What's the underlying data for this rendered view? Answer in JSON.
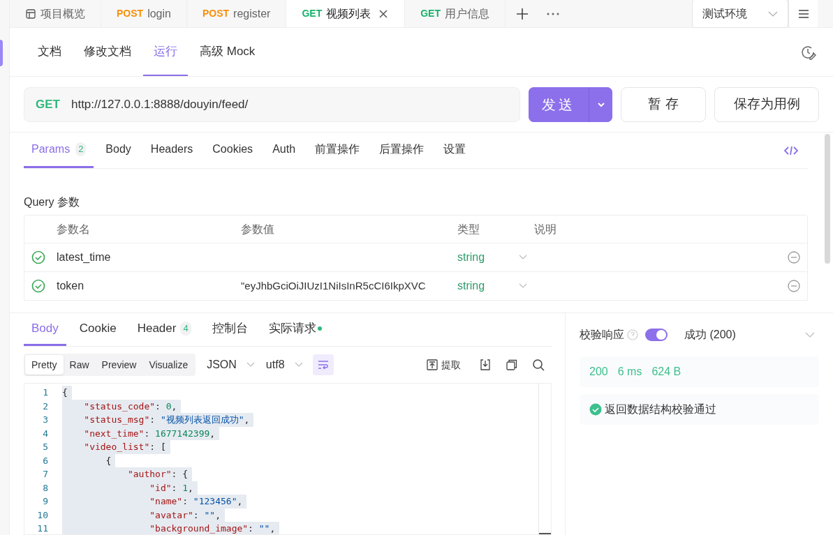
{
  "tabs": [
    {
      "kind": "overview",
      "label": "项目概览",
      "selected": false
    },
    {
      "method": "POST",
      "label": "login",
      "selected": false
    },
    {
      "method": "POST",
      "label": "register",
      "selected": false
    },
    {
      "method": "GET",
      "label": "视频列表",
      "selected": true
    },
    {
      "method": "GET",
      "label": "用户信息",
      "selected": false
    }
  ],
  "environment": "测试环境",
  "mode_tabs": [
    {
      "label": "文档",
      "selected": false
    },
    {
      "label": "修改文档",
      "selected": false
    },
    {
      "label": "运行",
      "selected": true
    },
    {
      "label": "高级 Mock",
      "selected": false
    }
  ],
  "request": {
    "method": "GET",
    "url": "http://127.0.0.1:8888/douyin/feed/",
    "send": "发送",
    "save": "暂 存",
    "save_case": "保存为用例"
  },
  "request_tabs": [
    {
      "label": "Params",
      "count": "2",
      "selected": true
    },
    {
      "label": "Body",
      "selected": false
    },
    {
      "label": "Headers",
      "selected": false
    },
    {
      "label": "Cookies",
      "selected": false
    },
    {
      "label": "Auth",
      "selected": false
    },
    {
      "label": "前置操作",
      "selected": false
    },
    {
      "label": "后置操作",
      "selected": false
    },
    {
      "label": "设置",
      "selected": false
    }
  ],
  "query_title": "Query 参数",
  "params": {
    "columns": [
      "参数名",
      "参数值",
      "类型",
      "说明"
    ],
    "rows": [
      {
        "enabled": true,
        "name": "latest_time",
        "type": "string"
      },
      {
        "enabled": true,
        "name": "token",
        "value": "\"eyJhbGciOiJIUzI1NiIsInR5cCI6IkpXVC",
        "type": "string"
      }
    ]
  },
  "response_tabs": [
    {
      "label": "Body",
      "selected": true
    },
    {
      "label": "Cookie",
      "selected": false
    },
    {
      "label": "Header",
      "count": "4",
      "selected": false
    },
    {
      "label": "控制台",
      "selected": false
    },
    {
      "label": "实际请求",
      "dot": true,
      "selected": false
    }
  ],
  "view_modes": [
    {
      "label": "Pretty",
      "selected": true
    },
    {
      "label": "Raw",
      "selected": false
    },
    {
      "label": "Preview",
      "selected": false
    },
    {
      "label": "Visualize",
      "selected": false
    }
  ],
  "format": "JSON",
  "encoding": "utf8",
  "extract": "提取",
  "code": [
    {
      "number": "1",
      "tokens": [
        {
          "kind": "punct",
          "s": "{"
        }
      ]
    },
    {
      "number": "2",
      "tokens": [
        {
          "kind": "key",
          "s": "    \"status_code\""
        },
        {
          "kind": "punct",
          "s": ": "
        },
        {
          "kind": "number",
          "s": "0"
        },
        {
          "kind": "punct",
          "s": ","
        }
      ]
    },
    {
      "number": "3",
      "tokens": [
        {
          "kind": "key",
          "s": "    \"status_msg\""
        },
        {
          "kind": "punct",
          "s": ": "
        },
        {
          "kind": "string",
          "s": "\"视频列表返回成功\""
        },
        {
          "kind": "punct",
          "s": ","
        }
      ]
    },
    {
      "number": "4",
      "tokens": [
        {
          "kind": "key",
          "s": "    \"next_time\""
        },
        {
          "kind": "punct",
          "s": ": "
        },
        {
          "kind": "number",
          "s": "1677142399"
        },
        {
          "kind": "punct",
          "s": ","
        }
      ]
    },
    {
      "number": "5",
      "tokens": [
        {
          "kind": "key",
          "s": "    \"video_list\""
        },
        {
          "kind": "punct",
          "s": ": ["
        }
      ]
    },
    {
      "number": "6",
      "tokens": [
        {
          "kind": "punct",
          "s": "        {"
        }
      ]
    },
    {
      "number": "7",
      "tokens": [
        {
          "kind": "key",
          "s": "            \"author\""
        },
        {
          "kind": "punct",
          "s": ": {"
        }
      ]
    },
    {
      "number": "8",
      "tokens": [
        {
          "kind": "key",
          "s": "                \"id\""
        },
        {
          "kind": "punct",
          "s": ": "
        },
        {
          "kind": "number",
          "s": "1"
        },
        {
          "kind": "punct",
          "s": ","
        }
      ]
    },
    {
      "number": "9",
      "tokens": [
        {
          "kind": "key",
          "s": "                \"name\""
        },
        {
          "kind": "punct",
          "s": ": "
        },
        {
          "kind": "string",
          "s": "\"123456\""
        },
        {
          "kind": "punct",
          "s": ","
        }
      ]
    },
    {
      "number": "10",
      "tokens": [
        {
          "kind": "key",
          "s": "                \"avatar\""
        },
        {
          "kind": "punct",
          "s": ": "
        },
        {
          "kind": "string",
          "s": "\"\""
        },
        {
          "kind": "punct",
          "s": ","
        }
      ]
    },
    {
      "number": "11",
      "tokens": [
        {
          "kind": "key",
          "s": "                \"background_image\""
        },
        {
          "kind": "punct",
          "s": ": "
        },
        {
          "kind": "string",
          "s": "\"\""
        },
        {
          "kind": "punct",
          "s": ","
        }
      ]
    }
  ],
  "validation": {
    "label": "校验响应",
    "on": true,
    "result": "成功 (200)",
    "status": "200",
    "time": "6 ms",
    "size": "624 B",
    "message": "返回数据结构校验通过"
  }
}
